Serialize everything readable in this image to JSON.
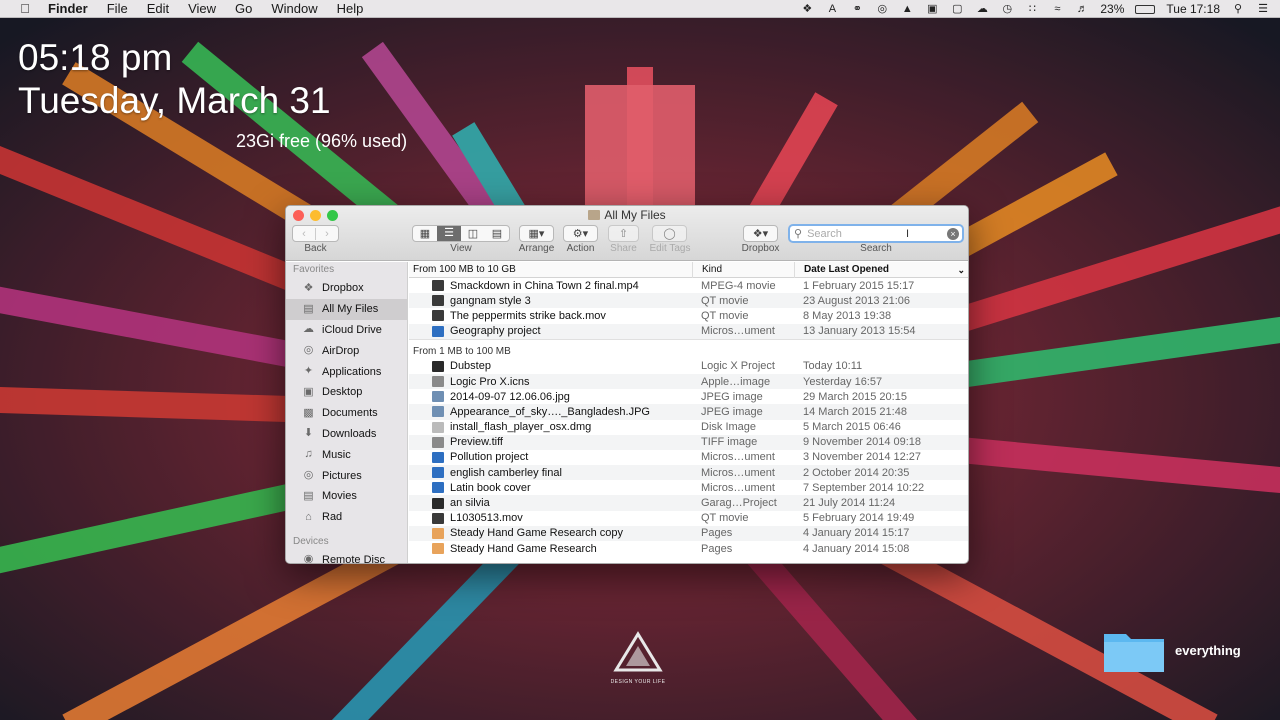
{
  "menubar": {
    "apple_icon": "apple-icon",
    "items": [
      "Finder",
      "File",
      "Edit",
      "View",
      "Go",
      "Window",
      "Help"
    ],
    "battery": "23%",
    "clock": "Tue 17:18"
  },
  "desktop": {
    "time": "05:18 pm",
    "date": "Tuesday, March 31",
    "disk": "23Gi free (96% used)",
    "folder_label": "everything",
    "logo_text": "DESIGN YOUR LIFE"
  },
  "finder": {
    "title": "All My Files",
    "toolbar": {
      "back_label": "Back",
      "view_label": "View",
      "arrange_label": "Arrange",
      "action_label": "Action",
      "share_label": "Share",
      "edit_tags_label": "Edit Tags",
      "dropbox_label": "Dropbox",
      "search_label": "Search",
      "search_placeholder": "Search"
    },
    "sidebar": {
      "favorites_heading": "Favorites",
      "favorites": [
        {
          "label": "Dropbox",
          "icon": "dropbox-icon"
        },
        {
          "label": "All My Files",
          "icon": "all-files-icon"
        },
        {
          "label": "iCloud Drive",
          "icon": "cloud-icon"
        },
        {
          "label": "AirDrop",
          "icon": "airdrop-icon"
        },
        {
          "label": "Applications",
          "icon": "applications-icon"
        },
        {
          "label": "Desktop",
          "icon": "desktop-icon"
        },
        {
          "label": "Documents",
          "icon": "documents-icon"
        },
        {
          "label": "Downloads",
          "icon": "downloads-icon"
        },
        {
          "label": "Music",
          "icon": "music-icon"
        },
        {
          "label": "Pictures",
          "icon": "camera-icon"
        },
        {
          "label": "Movies",
          "icon": "film-icon"
        },
        {
          "label": "Rad",
          "icon": "home-icon"
        }
      ],
      "devices_heading": "Devices",
      "devices": [
        {
          "label": "Remote Disc",
          "icon": "disc-icon"
        }
      ]
    },
    "columns": {
      "name": "From 100 MB to 10 GB",
      "kind": "Kind",
      "date": "Date Last Opened"
    },
    "group2_label": "From 1 MB to 100 MB",
    "group1": [
      {
        "name": "Smackdown in China Town 2 final.mp4",
        "kind": "MPEG-4 movie",
        "date": "1 February 2015 15:17"
      },
      {
        "name": "gangnam style 3",
        "kind": "QT movie",
        "date": "23 August 2013 21:06"
      },
      {
        "name": "The peppermits strike back.mov",
        "kind": "QT movie",
        "date": "8 May 2013 19:38"
      },
      {
        "name": "Geography project",
        "kind": "Micros…ument",
        "date": "13 January 2013 15:54"
      }
    ],
    "group2": [
      {
        "name": "Dubstep",
        "kind": "Logic X Project",
        "date": "Today 10:11"
      },
      {
        "name": "Logic Pro X.icns",
        "kind": "Apple…image",
        "date": "Yesterday 16:57"
      },
      {
        "name": "2014-09-07 12.06.06.jpg",
        "kind": "JPEG image",
        "date": "29 March 2015 20:15"
      },
      {
        "name": "Appearance_of_sky…._Bangladesh.JPG",
        "kind": "JPEG image",
        "date": "14 March 2015 21:48"
      },
      {
        "name": "install_flash_player_osx.dmg",
        "kind": "Disk Image",
        "date": "5 March 2015 06:46"
      },
      {
        "name": "Preview.tiff",
        "kind": "TIFF image",
        "date": "9 November 2014 09:18"
      },
      {
        "name": "Pollution project",
        "kind": "Micros…ument",
        "date": "3 November 2014 12:27"
      },
      {
        "name": "english camberley final",
        "kind": "Micros…ument",
        "date": "2 October 2014 20:35"
      },
      {
        "name": "Latin book cover",
        "kind": "Micros…ument",
        "date": "7 September 2014 10:22"
      },
      {
        "name": "an silvia",
        "kind": "Garag…Project",
        "date": "21 July 2014 11:24"
      },
      {
        "name": "L1030513.mov",
        "kind": "QT movie",
        "date": "5 February 2014 19:49"
      },
      {
        "name": "Steady Hand Game Research copy",
        "kind": "Pages",
        "date": "4 January 2014 15:17"
      },
      {
        "name": "Steady Hand Game Research",
        "kind": "Pages",
        "date": "4 January 2014 15:08"
      }
    ]
  },
  "colors": {
    "accent": "#3b82d6",
    "close": "#fc5f57",
    "minimize": "#fdbc2e",
    "zoom": "#33c748",
    "folder": "#5cb8f0"
  }
}
